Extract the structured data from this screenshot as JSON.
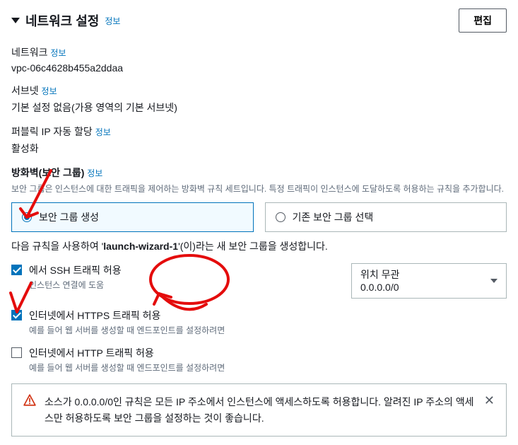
{
  "header": {
    "title": "네트워크 설정",
    "info": "정보",
    "edit": "편집"
  },
  "network": {
    "label": "네트워크",
    "info": "정보",
    "value": "vpc-06c4628b455a2ddaa"
  },
  "subnet": {
    "label": "서브넷",
    "info": "정보",
    "value": "기본 설정 없음(가용 영역의 기본 서브넷)"
  },
  "publicip": {
    "label": "퍼블릭 IP 자동 할당",
    "info": "정보",
    "value": "활성화"
  },
  "firewall": {
    "label": "방화벽(보안 그룹)",
    "info": "정보",
    "help": "보안 그룹은 인스턴스에 대한 트래픽을 제어하는 방화벽 규칙 세트입니다. 특정 트래픽이 인스턴스에 도달하도록 허용하는 규칙을 추가합니다.",
    "create": "보안 그룹 생성",
    "select": "기존 보안 그룹 선택"
  },
  "rule_desc": {
    "prefix": "다음 규칙을 사용하여 '",
    "name": "launch-wizard-1",
    "suffix": "'(이)라는 새 보안 그룹을 생성합니다."
  },
  "ssh": {
    "label": "에서 SSH 트래픽 허용",
    "help": "인스턴스 연결에 도움",
    "dropdown_label": "위치 무관",
    "dropdown_value": "0.0.0.0/0"
  },
  "https": {
    "label": "인터넷에서 HTTPS 트래픽 허용",
    "help": "예를 들어 웹 서버를 생성할 때 엔드포인트를 설정하려면"
  },
  "http": {
    "label": "인터넷에서 HTTP 트래픽 허용",
    "help": "예를 들어 웹 서버를 생성할 때 엔드포인트를 설정하려면"
  },
  "warning": {
    "text": "소스가 0.0.0.0/0인 규칙은 모든 IP 주소에서 인스턴스에 액세스하도록 허용합니다. 알려진 IP 주소의 액세스만 허용하도록 보안 그룹을 설정하는 것이 좋습니다."
  }
}
